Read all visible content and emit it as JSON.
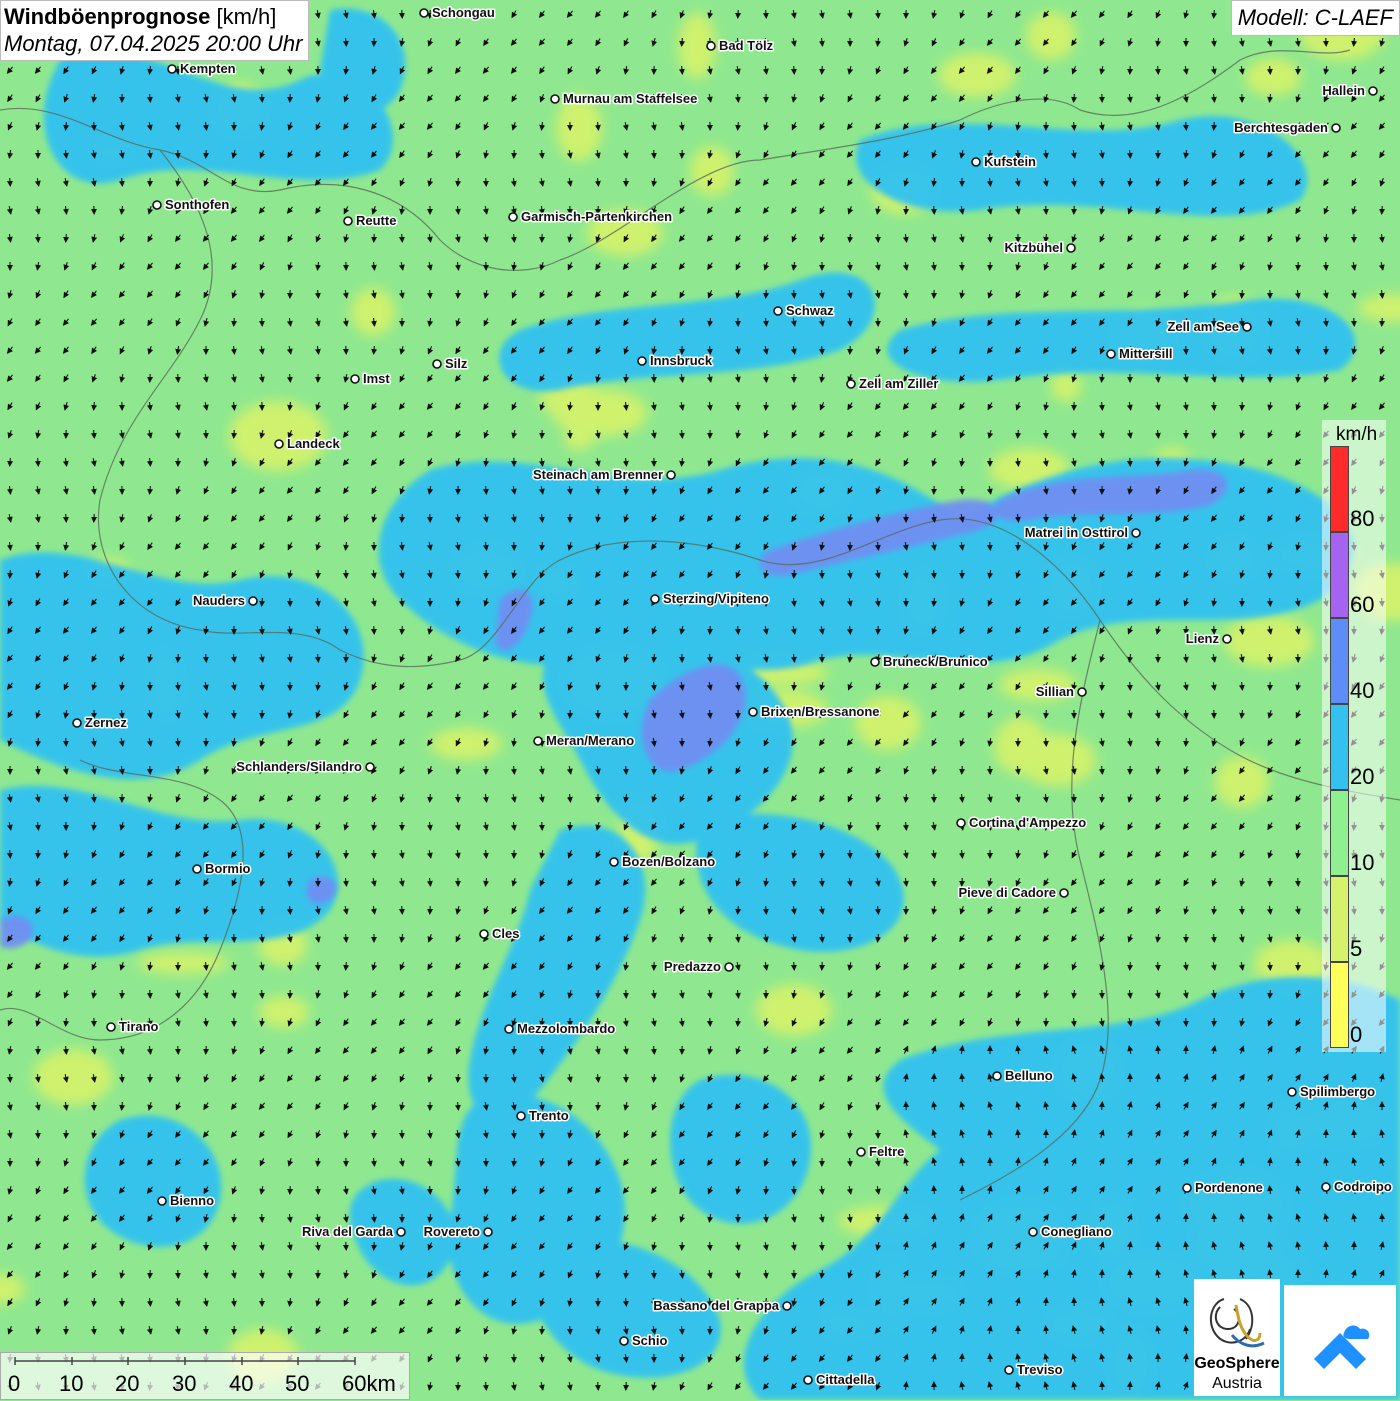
{
  "title": {
    "bold": "Windböenprognose",
    "unit": "[km/h]",
    "date": "Montag, 07.04.2025 20:00 Uhr"
  },
  "model": "Modell: C-LAEF",
  "legend": {
    "unit": "km/h",
    "levels": [
      {
        "label": "80",
        "color": "#ff2a2a"
      },
      {
        "label": "60",
        "color": "#a563f2"
      },
      {
        "label": "40",
        "color": "#5e8ef5"
      },
      {
        "label": "20",
        "color": "#33c2f0"
      },
      {
        "label": "10",
        "color": "#8ff08f"
      },
      {
        "label": "5",
        "color": "#d6f26b"
      },
      {
        "label": "0",
        "color": "#ffff5a"
      }
    ]
  },
  "scale": {
    "ticks": [
      "0",
      "10",
      "20",
      "30",
      "40",
      "50",
      "60km"
    ]
  },
  "logos": {
    "geosphere_line1": "GeoSphere",
    "geosphere_line2": "Austria"
  },
  "cities": [
    {
      "name": "Schongau",
      "icon": "city-dot"
    },
    {
      "name": "Bad Tölz",
      "icon": "city-dot"
    },
    {
      "name": "Kempten",
      "icon": "city-dot"
    },
    {
      "name": "Murnau am Staffelsee",
      "icon": "city-dot"
    },
    {
      "name": "Hallein",
      "icon": "city-dot"
    },
    {
      "name": "Berchtesgaden",
      "icon": "city-dot"
    },
    {
      "name": "Kufstein",
      "icon": "city-dot"
    },
    {
      "name": "Sonthofen",
      "icon": "city-dot"
    },
    {
      "name": "Reutte",
      "icon": "city-dot"
    },
    {
      "name": "Garmisch-Partenkirchen",
      "icon": "city-dot"
    },
    {
      "name": "Kitzbühel",
      "icon": "city-dot"
    },
    {
      "name": "Schwaz",
      "icon": "city-dot"
    },
    {
      "name": "Zell am See",
      "icon": "city-dot"
    },
    {
      "name": "Mittersill",
      "icon": "city-dot"
    },
    {
      "name": "Innsbruck",
      "icon": "city-dot"
    },
    {
      "name": "Silz",
      "icon": "city-dot"
    },
    {
      "name": "Imst",
      "icon": "city-dot"
    },
    {
      "name": "Zell am Ziller",
      "icon": "city-dot"
    },
    {
      "name": "Landeck",
      "icon": "city-dot"
    },
    {
      "name": "Steinach am Brenner",
      "icon": "city-dot"
    },
    {
      "name": "Matrei in Osttirol",
      "icon": "city-dot"
    },
    {
      "name": "Nauders",
      "icon": "city-dot"
    },
    {
      "name": "Sterzing/Vipiteno",
      "icon": "city-dot"
    },
    {
      "name": "Lienz",
      "icon": "city-dot"
    },
    {
      "name": "Bruneck/Brunico",
      "icon": "city-dot"
    },
    {
      "name": "Sillian",
      "icon": "city-dot"
    },
    {
      "name": "Brixen/Bressanone",
      "icon": "city-dot"
    },
    {
      "name": "Zernez",
      "icon": "city-dot"
    },
    {
      "name": "Meran/Merano",
      "icon": "city-dot"
    },
    {
      "name": "Schlanders/Silandro",
      "icon": "city-dot"
    },
    {
      "name": "Cortina d'Ampezzo",
      "icon": "city-dot"
    },
    {
      "name": "Bozen/Bolzano",
      "icon": "city-dot"
    },
    {
      "name": "Bormio",
      "icon": "city-dot"
    },
    {
      "name": "Pieve di Cadore",
      "icon": "city-dot"
    },
    {
      "name": "Cles",
      "icon": "city-dot"
    },
    {
      "name": "Predazzo",
      "icon": "city-dot"
    },
    {
      "name": "Tirano",
      "icon": "city-dot"
    },
    {
      "name": "Mezzolombardo",
      "icon": "city-dot"
    },
    {
      "name": "Belluno",
      "icon": "city-dot"
    },
    {
      "name": "Spilimbergo",
      "icon": "city-dot"
    },
    {
      "name": "Trento",
      "icon": "city-dot"
    },
    {
      "name": "Feltre",
      "icon": "city-dot"
    },
    {
      "name": "Pordenone",
      "icon": "city-dot"
    },
    {
      "name": "Codroipo",
      "icon": "city-dot"
    },
    {
      "name": "Bienno",
      "icon": "city-dot"
    },
    {
      "name": "Riva del Garda",
      "icon": "city-dot"
    },
    {
      "name": "Rovereto",
      "icon": "city-dot"
    },
    {
      "name": "Conegliano",
      "icon": "city-dot"
    },
    {
      "name": "Bassano del Grappa",
      "icon": "city-dot"
    },
    {
      "name": "Schio",
      "icon": "city-dot"
    },
    {
      "name": "Treviso",
      "icon": "city-dot"
    },
    {
      "name": "Cittadella",
      "icon": "city-dot"
    }
  ]
}
